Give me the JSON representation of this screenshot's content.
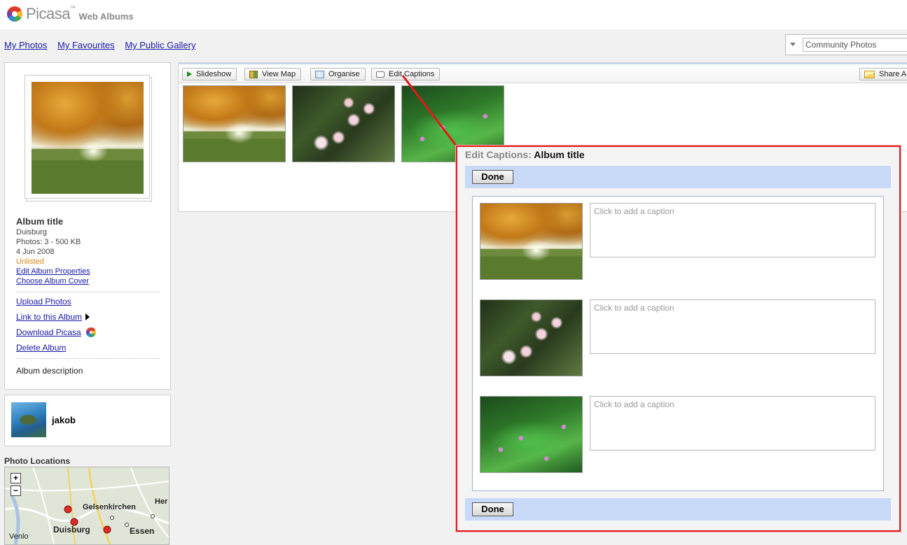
{
  "header": {
    "logo_name": "Picasa",
    "logo_tm": "™",
    "logo_sub": "Web Albums"
  },
  "nav": {
    "links": [
      "My Photos",
      "My Favourites",
      "My Public Gallery"
    ]
  },
  "community": {
    "value": "Community Photos"
  },
  "album": {
    "title": "Album title",
    "location": "Duisburg",
    "photos": "Photos: 3 - 500 KB",
    "date": "4 Jun 2008",
    "visibility": "Unlisted",
    "edit_properties": "Edit Album Properties",
    "choose_cover": "Choose Album Cover",
    "upload": "Upload Photos",
    "link": "Link to this Album",
    "download": "Download Picasa",
    "delete": "Delete Album",
    "description": "Album description"
  },
  "user": {
    "name": "jakob"
  },
  "locations": {
    "title": "Photo Locations",
    "zoom_in": "+",
    "zoom_out": "−",
    "places": [
      "Gelsenkirchen",
      "Her",
      "Duisburg",
      "Essen",
      "Venlo"
    ]
  },
  "toolbar": {
    "slideshow": "Slideshow",
    "view_map": "View Map",
    "organise": "Organise",
    "edit_captions": "Edit Captions",
    "share": "Share A"
  },
  "dialog": {
    "title_prefix": "Edit Captions:",
    "title": "Album title",
    "done_label": "Done",
    "caption_placeholder": "Click to add a caption"
  },
  "colors": {
    "highlight": "#e21a1a",
    "dialog_bar": "#c8daf8",
    "link": "#1a1aa6",
    "unlisted": "#d58a1a"
  }
}
